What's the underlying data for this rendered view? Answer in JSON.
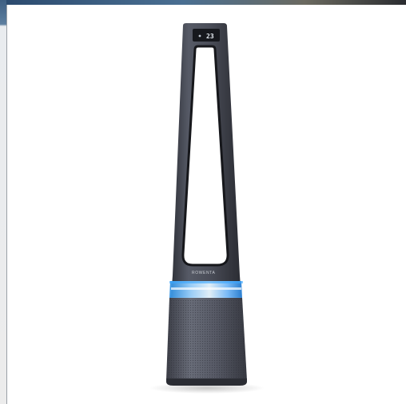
{
  "product": {
    "brand_label": "ROWENTA",
    "display_value": "23",
    "colors": {
      "body": "#4a4d57",
      "body_dark": "#2c2e35",
      "ring_glow": "#3aa6ff",
      "background": "#ffffff"
    }
  }
}
